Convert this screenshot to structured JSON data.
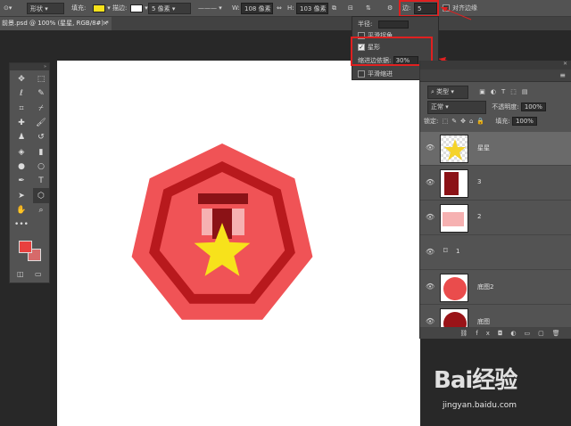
{
  "optbar": {
    "mode": "形状",
    "fill_label": "填充:",
    "fill_color": "#f7e21b",
    "stroke_label": "描边:",
    "stroke_size": "5 像素",
    "width_label": "W:",
    "width_value": "108 像素",
    "height_label": "H:",
    "height_value": "103 像素",
    "sides_label": "边:",
    "sides_value": "5",
    "align_label": "对齐边缘"
  },
  "tab": {
    "title": "前景.psd @ 100% (星星, RGB/8#) *",
    "close": "×"
  },
  "popup": {
    "radius_label": "半径:",
    "smooth_corners": "平滑拐角",
    "star_label": "星形",
    "indent_label": "缩进边依据:",
    "indent_value": "30%",
    "smooth_indent": "平滑缩进"
  },
  "layers_panel": {
    "filter_label": "类型",
    "blend_mode": "正常",
    "opacity_label": "不透明度:",
    "opacity_value": "100%",
    "lock_label": "锁定:",
    "fill_label": "填充:",
    "fill_value": "100%",
    "layers": [
      {
        "name": "星星",
        "color": "#f5d32a"
      },
      {
        "name": "3",
        "color": "#8b1216"
      },
      {
        "name": "2",
        "color": "#f6b1b1"
      },
      {
        "name": "1",
        "color": ""
      },
      {
        "name": "底图2",
        "color": "#ea4c4c"
      },
      {
        "name": "底图",
        "color": "#9a1418"
      }
    ]
  },
  "watermark": {
    "brand": "Bai经验",
    "url": "jingyan.baidu.com"
  },
  "colors": {
    "foreground": "#e8403e",
    "background": "#d66a6a",
    "badge_outer": "#f05356",
    "badge_ring": "#b8191d",
    "ribbon_dark": "#8b1216",
    "ribbon_light": "#f6b1b1",
    "star": "#f7e21b",
    "highlight": "#e02020"
  }
}
